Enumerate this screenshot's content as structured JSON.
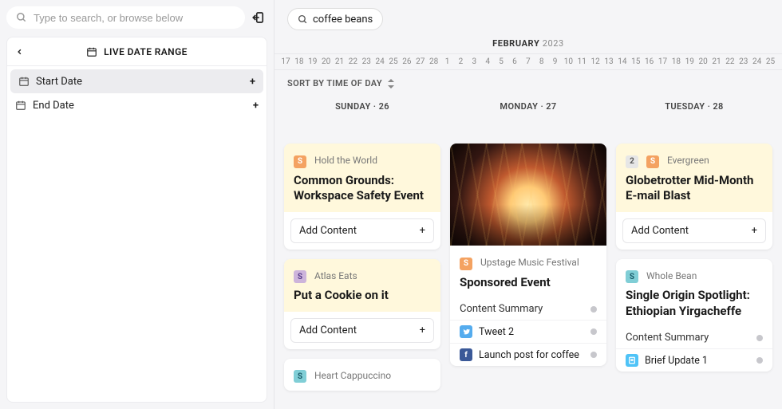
{
  "sidebar": {
    "search_placeholder": "Type to search, or browse below",
    "live_date_range": "LIVE DATE RANGE",
    "start_date": "Start Date",
    "end_date": "End Date",
    "plus": "+"
  },
  "topbar": {
    "chip_text": "coffee beans"
  },
  "timeline": {
    "month": "FEBRUARY",
    "year": "2023",
    "days": [
      "17",
      "18",
      "19",
      "20",
      "21",
      "22",
      "23",
      "24",
      "25",
      "26",
      "27",
      "28",
      "1",
      "2",
      "3",
      "4",
      "5",
      "6",
      "7",
      "8",
      "9",
      "10",
      "11",
      "12",
      "13",
      "14",
      "15",
      "16",
      "17",
      "18",
      "19",
      "20",
      "21",
      "22",
      "23",
      "24",
      "25"
    ],
    "sort_label": "SORT BY TIME OF DAY"
  },
  "columns": {
    "sunday": {
      "header": "SUNDAY · 26",
      "cards": [
        {
          "badge": "S",
          "badge_color": "orange",
          "tag": "Hold the World",
          "title": "Common Grounds: Workspace Safety Event",
          "add": "Add Content"
        },
        {
          "badge": "S",
          "badge_color": "purple",
          "tag": "Atlas Eats",
          "title": "Put a Cookie on it",
          "add": "Add Content"
        },
        {
          "badge": "S",
          "badge_color": "teal",
          "tag": "Heart Cappuccino",
          "title": ""
        }
      ]
    },
    "monday": {
      "header": "MONDAY · 27",
      "cards": [
        {
          "badge": "S",
          "badge_color": "orange",
          "tag": "Upstage Music Festival",
          "title": "Sponsored Event",
          "summary": "Content Summary",
          "items": [
            {
              "icon": "tw",
              "label": "Tweet 2"
            },
            {
              "icon": "fb",
              "label": "Launch post for coffee"
            }
          ]
        }
      ]
    },
    "tuesday": {
      "header": "TUESDAY · 28",
      "cards": [
        {
          "badges": [
            {
              "text": "2",
              "color": "grey"
            },
            {
              "text": "S",
              "color": "orange"
            }
          ],
          "tag": "Evergreen",
          "title": "Globetrotter Mid-Month E-mail Blast",
          "add": "Add Content"
        },
        {
          "badge": "S",
          "badge_color": "teal",
          "tag": "Whole Bean",
          "title": "Single Origin Spotlight: Ethiopian Yirgacheffe",
          "summary": "Content Summary",
          "items": [
            {
              "icon": "doc",
              "label": "Brief Update 1"
            }
          ]
        }
      ]
    }
  }
}
